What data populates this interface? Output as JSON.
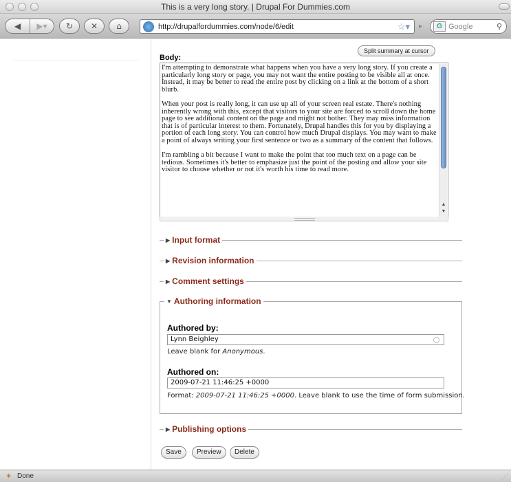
{
  "window": {
    "title": "This is a very long story. | Drupal For Dummies.com"
  },
  "toolbar": {
    "url": "http://drupalfordummies.com/node/6/edit",
    "search_placeholder": "Google"
  },
  "editor": {
    "split_button": "Split summary at cursor",
    "body_label": "Body:",
    "body_paragraphs": [
      "I'm attempting to demonstrate what happens when you have a very long story. If you create a particularly long story or page, you may not want the entire posting to be visible all at once. Instead, it may be better to read the entire post by clicking on a link at the bottom of a short blurb.",
      "When your post is really long, it can use up all of your screen real estate. There's nothing inherently wrong with this, except that visitors to your site are forced to scroll down the home page to see additional content on the page and might not bother. They may miss information that is of particular interest to them. Fortunately, Drupal handles this for you by displaying a portion of each long story. You can control how much Drupal displays. You may want to make a point of always writing your first sentence or two as a summary of the content that follows.",
      "I'm rambling a bit because I want to make the point that too much text on a page can be tedious. Sometimes it's better to emphasize just the point of the posting and allow your site visitor to choose whether or not it's worth his time to read more."
    ]
  },
  "sections": {
    "input_format": "Input format",
    "revision_information": "Revision information",
    "comment_settings": "Comment settings",
    "authoring_information": "Authoring information",
    "publishing_options": "Publishing options"
  },
  "authoring": {
    "authored_by_label": "Authored by:",
    "authored_by_value": "Lynn Beighley",
    "authored_by_help_prefix": "Leave blank for ",
    "authored_by_help_em": "Anonymous",
    "authored_by_help_suffix": ".",
    "authored_on_label": "Authored on:",
    "authored_on_value": "2009-07-21 11:46:25 +0000",
    "authored_on_help_prefix": "Format: ",
    "authored_on_help_em": "2009-07-21 11:46:25 +0000",
    "authored_on_help_suffix": ". Leave blank to use the time of form submission."
  },
  "buttons": {
    "save": "Save",
    "preview": "Preview",
    "delete": "Delete"
  },
  "statusbar": {
    "text": "Done"
  }
}
